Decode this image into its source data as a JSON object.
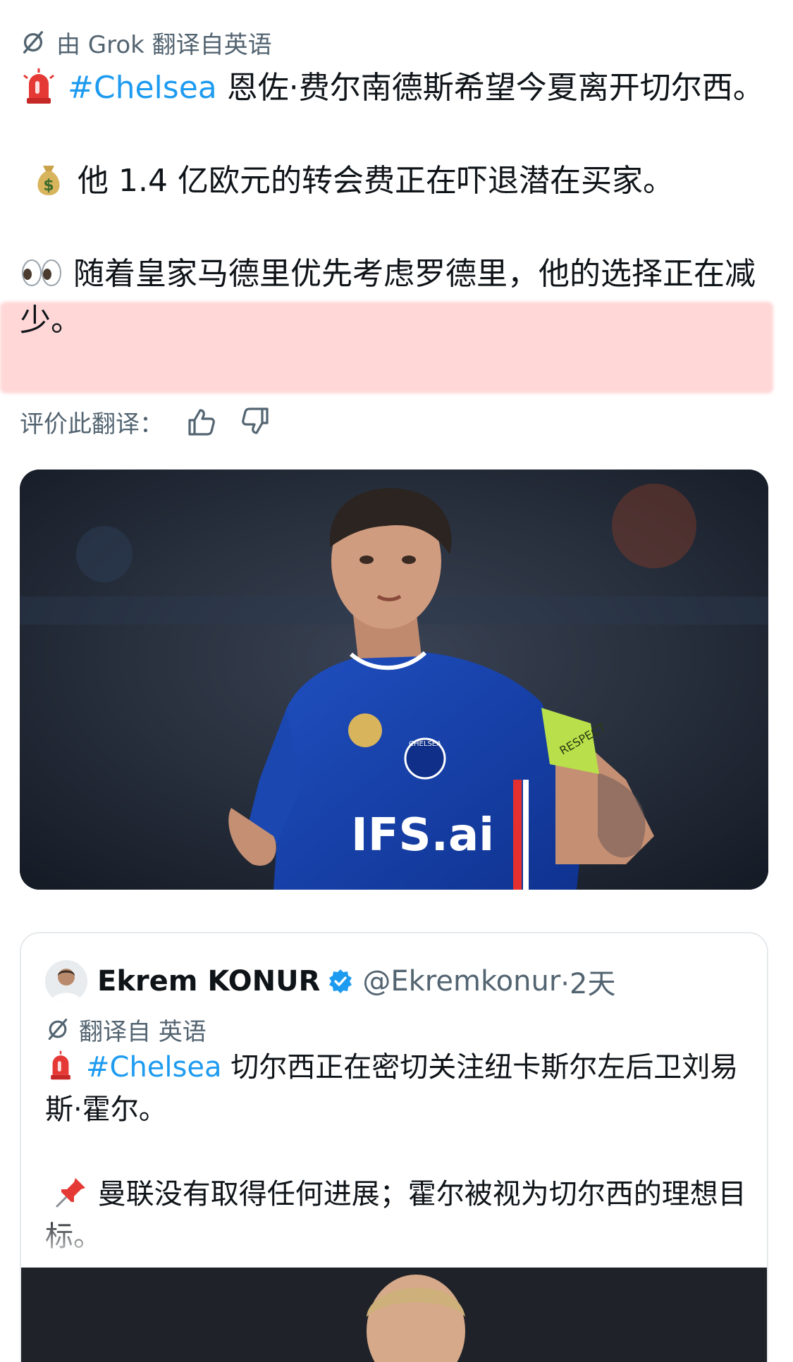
{
  "translation_notice": {
    "text": "由 Grok 翻译自英语"
  },
  "post": {
    "line1_prefix_icon": "siren-emoji",
    "hashtag": "#Chelsea",
    "line1_text": " 恩佐·费尔南德斯希望今夏离开切尔西。",
    "line2_icon": "money-bag-emoji",
    "line2_text": "他 1.4 亿欧元的转会费正在吓退潜在买家。",
    "line3_icon": "eyes-emoji",
    "line3_text": "随着皇家马德里优先考虑罗德里，他的选择正在减少。"
  },
  "rate": {
    "label": "评价此翻译：",
    "like_icon": "thumbs-up-icon",
    "dislike_icon": "thumbs-down-icon"
  },
  "media1": {
    "jersey_text": "IFS.ai",
    "club_text": "CHELSEA",
    "armband_text": "RESPECT"
  },
  "quote": {
    "name": "Ekrem KONUR",
    "handle": "@Ekremkonur",
    "time": "·2天",
    "translate_label": "翻译自 英语",
    "hashtag": "#Chelsea",
    "line1_text": " 切尔西正在密切关注纽卡斯尔左后卫刘易斯·霍尔。",
    "line2_text": "曼联没有取得任何进展；霍尔被视为切尔西的理想目标。"
  },
  "colors": {
    "link": "#1d9bf0",
    "secondary": "#536471",
    "verified": "#1d9bf0",
    "highlight": "#ffb4b4"
  }
}
